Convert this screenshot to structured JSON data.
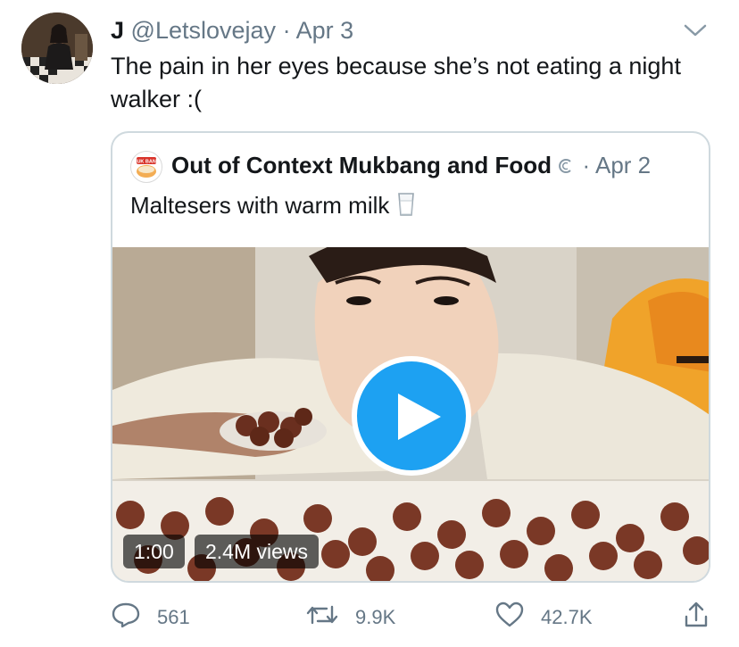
{
  "tweet": {
    "display_name": "J",
    "handle": "@Letslovejay",
    "separator": "·",
    "date": "Apr 3",
    "text": "The pain in her eyes because she’s not eating a night walker :("
  },
  "quoted": {
    "display_name": "Out of Context Mukbang and Food",
    "separator": "·",
    "date": "Apr 2",
    "text": "Maltesers with warm milk",
    "avatar_text": "MUK BANG",
    "video": {
      "duration": "1:00",
      "views": "2.4M views"
    }
  },
  "actions": {
    "replies": "561",
    "retweets": "9.9K",
    "likes": "42.7K"
  },
  "colors": {
    "accent": "#1da1f2",
    "muted": "#657786",
    "border": "#cfd9de"
  }
}
